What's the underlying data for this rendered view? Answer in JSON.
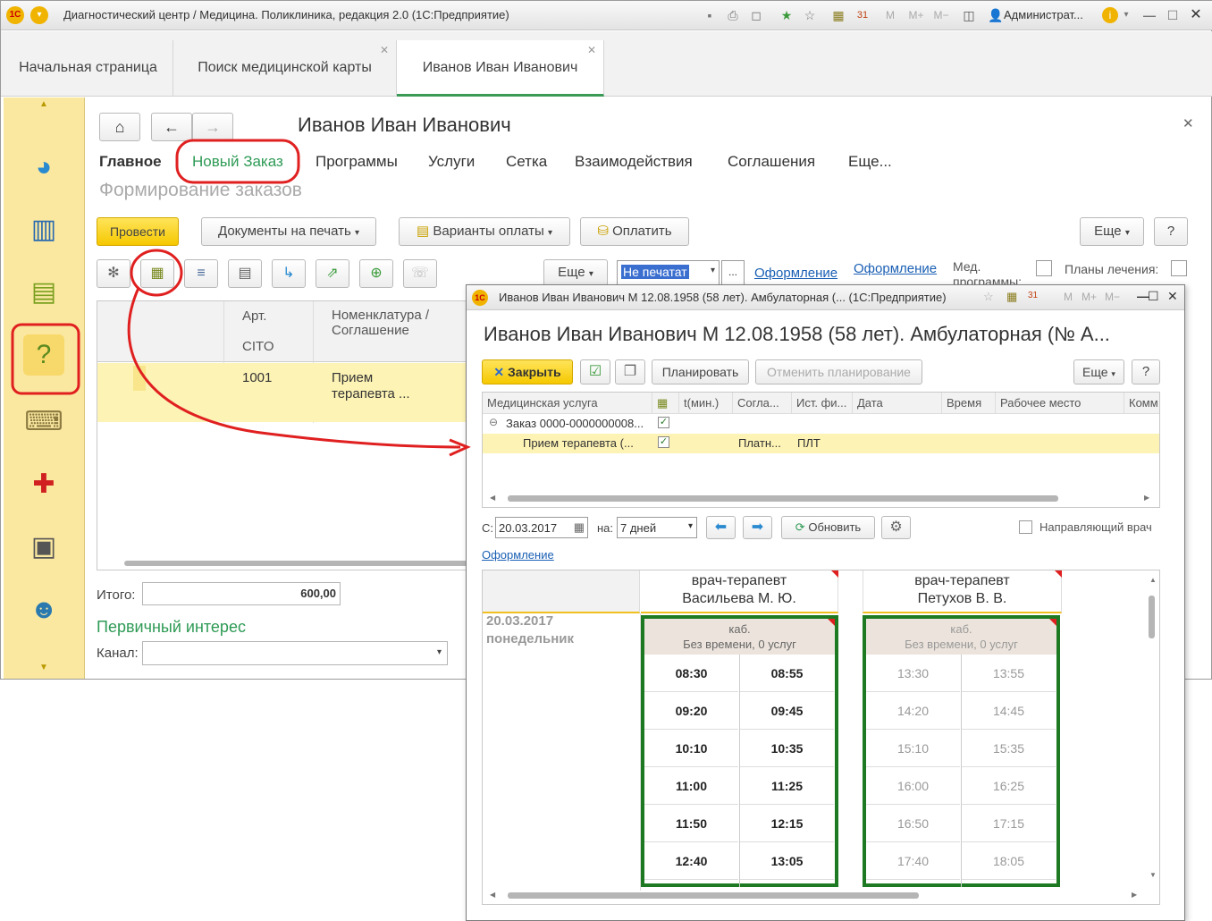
{
  "window": {
    "title": "Диагностический центр / Медицина. Поликлиника, редакция 2.0  (1С:Предприятие)",
    "user": "Администрат..."
  },
  "tabs": [
    {
      "label": "Начальная страница"
    },
    {
      "label": "Поиск медицинской карты"
    },
    {
      "label": "Иванов Иван Иванович"
    }
  ],
  "form": {
    "title": "Иванов Иван Иванович",
    "nav": [
      "Главное",
      "Новый Заказ",
      "Программы",
      "Услуги",
      "Сетка",
      "Взаимодействия",
      "Соглашения",
      "Еще..."
    ],
    "subtitle": "Формирование заказов",
    "toolbar": {
      "post": "Провести",
      "print_docs": "Документы на печать",
      "pay_options": "Варианты оплаты",
      "pay": "Оплатить",
      "more": "Еще",
      "help": "?",
      "more2": "Еще",
      "print_select": "Не печатат",
      "link1": "Оформление",
      "link2": "Оформление",
      "med_programs": "Мед. программы:",
      "treatment_plans": "Планы лечения:"
    },
    "table": {
      "headers": [
        "Арт.",
        "CITO",
        "Номенклатура / Соглашение"
      ],
      "row": {
        "art": "1001",
        "name": "Прием терапевта ..."
      }
    },
    "total_label": "Итого:",
    "total_value": "600,00",
    "interest_title": "Первичный интерес",
    "channel_label": "Канал:"
  },
  "dialog": {
    "title": "Иванов Иван Иванович М 12.08.1958 (58 лет). Амбулаторная (... (1С:Предприятие)",
    "heading": "Иванов Иван Иванович М 12.08.1958 (58 лет). Амбулаторная (№ А...",
    "toolbar": {
      "close": "Закрыть",
      "plan": "Планировать",
      "cancel_plan": "Отменить планирование",
      "more": "Еще",
      "help": "?"
    },
    "columns": [
      "Медицинская услуга",
      "t(мин.)",
      "Согла...",
      "Ист. фи...",
      "Дата",
      "Время",
      "Рабочее место",
      "Комм"
    ],
    "rows": [
      {
        "service": "Заказ 0000-0000000008...",
        "checked": true,
        "agreement": "",
        "source": ""
      },
      {
        "service": "Прием терапевта (...",
        "checked": true,
        "agreement": "Платн...",
        "source": "ПЛТ"
      }
    ],
    "filter": {
      "from_label": "С:",
      "from_date": "20.03.2017",
      "period_label": "на:",
      "period": "7 дней",
      "refresh": "Обновить",
      "referring_doctor": "Направляющий врач"
    },
    "design_link": "Оформление",
    "day": {
      "date": "20.03.2017",
      "weekday": "понедельник"
    },
    "doctors": [
      {
        "role": "врач-терапевт",
        "name": "Васильева М. Ю.",
        "cabinet": "каб.",
        "summary": "Без времени, 0 услуг",
        "slots": [
          "08:30",
          "08:55",
          "09:20",
          "09:45",
          "10:10",
          "10:35",
          "11:00",
          "11:25",
          "11:50",
          "12:15",
          "12:40",
          "13:05"
        ],
        "active": true
      },
      {
        "role": "врач-терапевт",
        "name": "Петухов В. В.",
        "cabinet": "каб.",
        "summary": "Без времени, 0 услуг",
        "slots": [
          "13:30",
          "13:55",
          "14:20",
          "14:45",
          "15:10",
          "15:35",
          "16:00",
          "16:25",
          "16:50",
          "17:15",
          "17:40",
          "18:05"
        ],
        "active": false
      }
    ]
  },
  "colors": {
    "accent_green": "#2e9a55",
    "highlight_yellow": "#fdf3b5",
    "sidebar_yellow": "#fbe8a0",
    "annotation_red": "#e02020",
    "slot_border_green": "#1e7a22"
  }
}
